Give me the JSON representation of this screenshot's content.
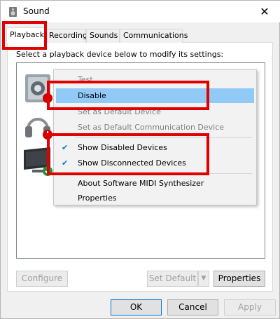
{
  "window": {
    "title": "Sound",
    "close_glyph": "✕"
  },
  "tabs": [
    {
      "label": "Playback"
    },
    {
      "label": "Recording"
    },
    {
      "label": "Sounds"
    },
    {
      "label": "Communications"
    }
  ],
  "instruction": "Select a playback device below to modify its settings:",
  "context_menu": {
    "items": [
      {
        "label": "Test"
      },
      {
        "label": "Disable"
      },
      {
        "label": "Set as Default Device"
      },
      {
        "label": "Set as Default Communication Device"
      },
      {
        "label": "Show Disabled Devices",
        "checked": true
      },
      {
        "label": "Show Disconnected Devices",
        "checked": true
      },
      {
        "label": "About Software MIDI Synthesizer"
      },
      {
        "label": "Properties"
      }
    ],
    "check_glyph": "✔"
  },
  "buttons": {
    "configure": "Configure",
    "set_default": "Set Default",
    "set_default_arrow": "▼",
    "properties": "Properties",
    "ok": "OK",
    "cancel": "Cancel",
    "apply": "Apply"
  },
  "colors": {
    "highlight": "#e00000",
    "menu_hover": "#91c9f7",
    "focus": "#0078d7"
  }
}
